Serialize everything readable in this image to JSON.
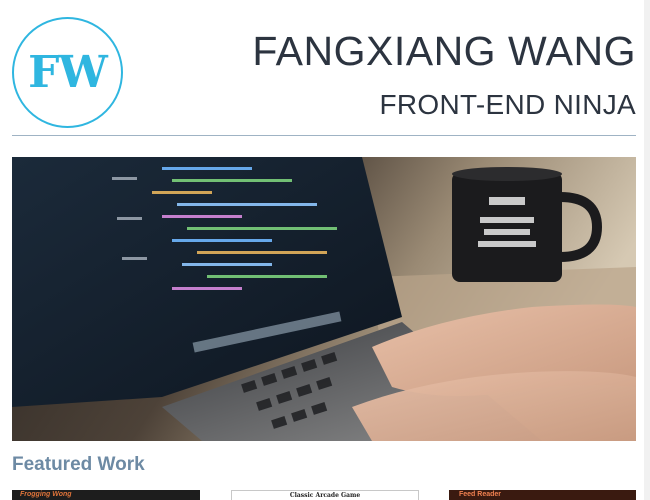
{
  "header": {
    "logo_text": "FW",
    "name": "FANGXIANG WANG",
    "title": "FRONT-END NINJA"
  },
  "hero": {
    "image_description_icon": "laptop-coding-photo"
  },
  "featured": {
    "heading": "Featured Work",
    "items": [
      {
        "label": "Frogging Wong"
      },
      {
        "label": "Classic Arcade Game"
      },
      {
        "label": "Feed Reader"
      }
    ]
  },
  "colors": {
    "accent": "#2fb6e0",
    "heading_text": "#2c3440",
    "featured_heading": "#6d8aa4",
    "divider": "#9fb3c4"
  }
}
